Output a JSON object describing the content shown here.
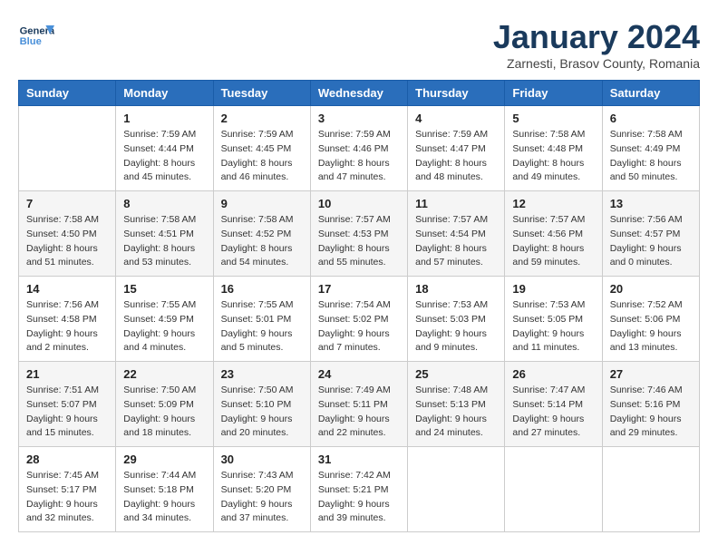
{
  "header": {
    "logo_line1": "General",
    "logo_line2": "Blue",
    "title": "January 2024",
    "subtitle": "Zarnesti, Brasov County, Romania"
  },
  "weekdays": [
    "Sunday",
    "Monday",
    "Tuesday",
    "Wednesday",
    "Thursday",
    "Friday",
    "Saturday"
  ],
  "weeks": [
    [
      {
        "day": "",
        "info": ""
      },
      {
        "day": "1",
        "info": "Sunrise: 7:59 AM\nSunset: 4:44 PM\nDaylight: 8 hours\nand 45 minutes."
      },
      {
        "day": "2",
        "info": "Sunrise: 7:59 AM\nSunset: 4:45 PM\nDaylight: 8 hours\nand 46 minutes."
      },
      {
        "day": "3",
        "info": "Sunrise: 7:59 AM\nSunset: 4:46 PM\nDaylight: 8 hours\nand 47 minutes."
      },
      {
        "day": "4",
        "info": "Sunrise: 7:59 AM\nSunset: 4:47 PM\nDaylight: 8 hours\nand 48 minutes."
      },
      {
        "day": "5",
        "info": "Sunrise: 7:58 AM\nSunset: 4:48 PM\nDaylight: 8 hours\nand 49 minutes."
      },
      {
        "day": "6",
        "info": "Sunrise: 7:58 AM\nSunset: 4:49 PM\nDaylight: 8 hours\nand 50 minutes."
      }
    ],
    [
      {
        "day": "7",
        "info": "Sunrise: 7:58 AM\nSunset: 4:50 PM\nDaylight: 8 hours\nand 51 minutes."
      },
      {
        "day": "8",
        "info": "Sunrise: 7:58 AM\nSunset: 4:51 PM\nDaylight: 8 hours\nand 53 minutes."
      },
      {
        "day": "9",
        "info": "Sunrise: 7:58 AM\nSunset: 4:52 PM\nDaylight: 8 hours\nand 54 minutes."
      },
      {
        "day": "10",
        "info": "Sunrise: 7:57 AM\nSunset: 4:53 PM\nDaylight: 8 hours\nand 55 minutes."
      },
      {
        "day": "11",
        "info": "Sunrise: 7:57 AM\nSunset: 4:54 PM\nDaylight: 8 hours\nand 57 minutes."
      },
      {
        "day": "12",
        "info": "Sunrise: 7:57 AM\nSunset: 4:56 PM\nDaylight: 8 hours\nand 59 minutes."
      },
      {
        "day": "13",
        "info": "Sunrise: 7:56 AM\nSunset: 4:57 PM\nDaylight: 9 hours\nand 0 minutes."
      }
    ],
    [
      {
        "day": "14",
        "info": "Sunrise: 7:56 AM\nSunset: 4:58 PM\nDaylight: 9 hours\nand 2 minutes."
      },
      {
        "day": "15",
        "info": "Sunrise: 7:55 AM\nSunset: 4:59 PM\nDaylight: 9 hours\nand 4 minutes."
      },
      {
        "day": "16",
        "info": "Sunrise: 7:55 AM\nSunset: 5:01 PM\nDaylight: 9 hours\nand 5 minutes."
      },
      {
        "day": "17",
        "info": "Sunrise: 7:54 AM\nSunset: 5:02 PM\nDaylight: 9 hours\nand 7 minutes."
      },
      {
        "day": "18",
        "info": "Sunrise: 7:53 AM\nSunset: 5:03 PM\nDaylight: 9 hours\nand 9 minutes."
      },
      {
        "day": "19",
        "info": "Sunrise: 7:53 AM\nSunset: 5:05 PM\nDaylight: 9 hours\nand 11 minutes."
      },
      {
        "day": "20",
        "info": "Sunrise: 7:52 AM\nSunset: 5:06 PM\nDaylight: 9 hours\nand 13 minutes."
      }
    ],
    [
      {
        "day": "21",
        "info": "Sunrise: 7:51 AM\nSunset: 5:07 PM\nDaylight: 9 hours\nand 15 minutes."
      },
      {
        "day": "22",
        "info": "Sunrise: 7:50 AM\nSunset: 5:09 PM\nDaylight: 9 hours\nand 18 minutes."
      },
      {
        "day": "23",
        "info": "Sunrise: 7:50 AM\nSunset: 5:10 PM\nDaylight: 9 hours\nand 20 minutes."
      },
      {
        "day": "24",
        "info": "Sunrise: 7:49 AM\nSunset: 5:11 PM\nDaylight: 9 hours\nand 22 minutes."
      },
      {
        "day": "25",
        "info": "Sunrise: 7:48 AM\nSunset: 5:13 PM\nDaylight: 9 hours\nand 24 minutes."
      },
      {
        "day": "26",
        "info": "Sunrise: 7:47 AM\nSunset: 5:14 PM\nDaylight: 9 hours\nand 27 minutes."
      },
      {
        "day": "27",
        "info": "Sunrise: 7:46 AM\nSunset: 5:16 PM\nDaylight: 9 hours\nand 29 minutes."
      }
    ],
    [
      {
        "day": "28",
        "info": "Sunrise: 7:45 AM\nSunset: 5:17 PM\nDaylight: 9 hours\nand 32 minutes."
      },
      {
        "day": "29",
        "info": "Sunrise: 7:44 AM\nSunset: 5:18 PM\nDaylight: 9 hours\nand 34 minutes."
      },
      {
        "day": "30",
        "info": "Sunrise: 7:43 AM\nSunset: 5:20 PM\nDaylight: 9 hours\nand 37 minutes."
      },
      {
        "day": "31",
        "info": "Sunrise: 7:42 AM\nSunset: 5:21 PM\nDaylight: 9 hours\nand 39 minutes."
      },
      {
        "day": "",
        "info": ""
      },
      {
        "day": "",
        "info": ""
      },
      {
        "day": "",
        "info": ""
      }
    ]
  ]
}
